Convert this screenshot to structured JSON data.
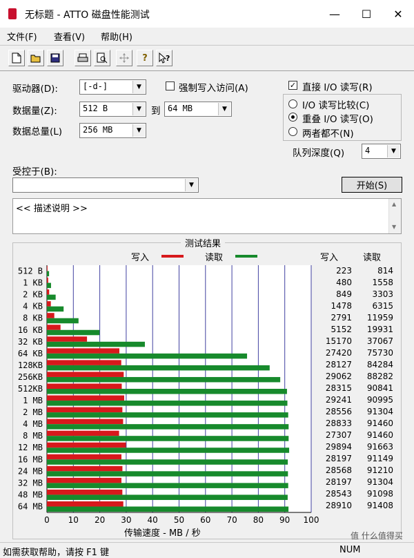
{
  "window": {
    "title": "无标题 - ATTO 磁盘性能测试",
    "minimize": "—",
    "maximize": "☐",
    "close": "✕"
  },
  "menu": [
    "文件(F)",
    "查看(V)",
    "帮助(H)"
  ],
  "toolbar": [
    "new-file-icon",
    "open-folder-icon",
    "save-icon",
    "print-icon",
    "print-preview-icon",
    "move-icon",
    "help-icon",
    "context-help-icon"
  ],
  "form": {
    "drive_label": "驱动器(D):",
    "drive_value": "[-d-]",
    "force_write_label": "强制写入访问(A)",
    "force_write_checked": false,
    "transfer_label": "数据量(Z):",
    "transfer_from": "512 B",
    "to_label": "到",
    "transfer_to": "64 MB",
    "total_label": "数据总量(L)",
    "total_value": "256 MB",
    "direct_io_label": "直接 I/O 读写(R)",
    "direct_io_checked": true,
    "radio_compare": "I/O 读写比较(C)",
    "radio_overlap": "重叠 I/O 读写(O)",
    "radio_neither": "两者都不(N)",
    "queue_label": "队列深度(Q)",
    "queue_value": "4",
    "controlled_label": "受控于(B):",
    "controlled_value": "",
    "start_button": "开始(S)",
    "description": "<< 描述说明 >>"
  },
  "results": {
    "title": "测试结果",
    "legend_write": "写入",
    "legend_read": "读取",
    "col_write": "写入",
    "col_read": "读取",
    "colors": {
      "write": "#d7191c",
      "read": "#178a2c",
      "grid": "#4040a0"
    },
    "status": "如需获取帮助，请按 F1 键",
    "num_indicator": "NUM",
    "watermark": "值 什么值得买"
  },
  "chart_data": {
    "type": "bar",
    "orientation": "horizontal",
    "categories": [
      "512 B",
      "1 KB",
      "2 KB",
      "4 KB",
      "8 KB",
      "16 KB",
      "32 KB",
      "64 KB",
      "128KB",
      "256KB",
      "512KB",
      "1 MB",
      "2 MB",
      "4 MB",
      "8 MB",
      "12 MB",
      "16 MB",
      "24 MB",
      "32 MB",
      "48 MB",
      "64 MB"
    ],
    "series": [
      {
        "name": "写入",
        "values": [
          223,
          480,
          849,
          1478,
          2791,
          5152,
          15170,
          27420,
          28127,
          29062,
          28315,
          29241,
          28556,
          28833,
          27307,
          29894,
          28197,
          28568,
          28197,
          28543,
          28910
        ]
      },
      {
        "name": "读取",
        "values": [
          814,
          1558,
          3303,
          6315,
          11959,
          19931,
          37067,
          75730,
          84284,
          88282,
          90841,
          90995,
          91304,
          91460,
          91460,
          91663,
          91149,
          91210,
          91304,
          91098,
          91408
        ]
      }
    ],
    "xlim": [
      0,
      100
    ],
    "xticks": [
      0,
      10,
      20,
      30,
      40,
      50,
      60,
      70,
      80,
      90,
      100
    ],
    "xlabel": "传输速度 - MB / 秒",
    "grid": true,
    "legend": "top"
  }
}
